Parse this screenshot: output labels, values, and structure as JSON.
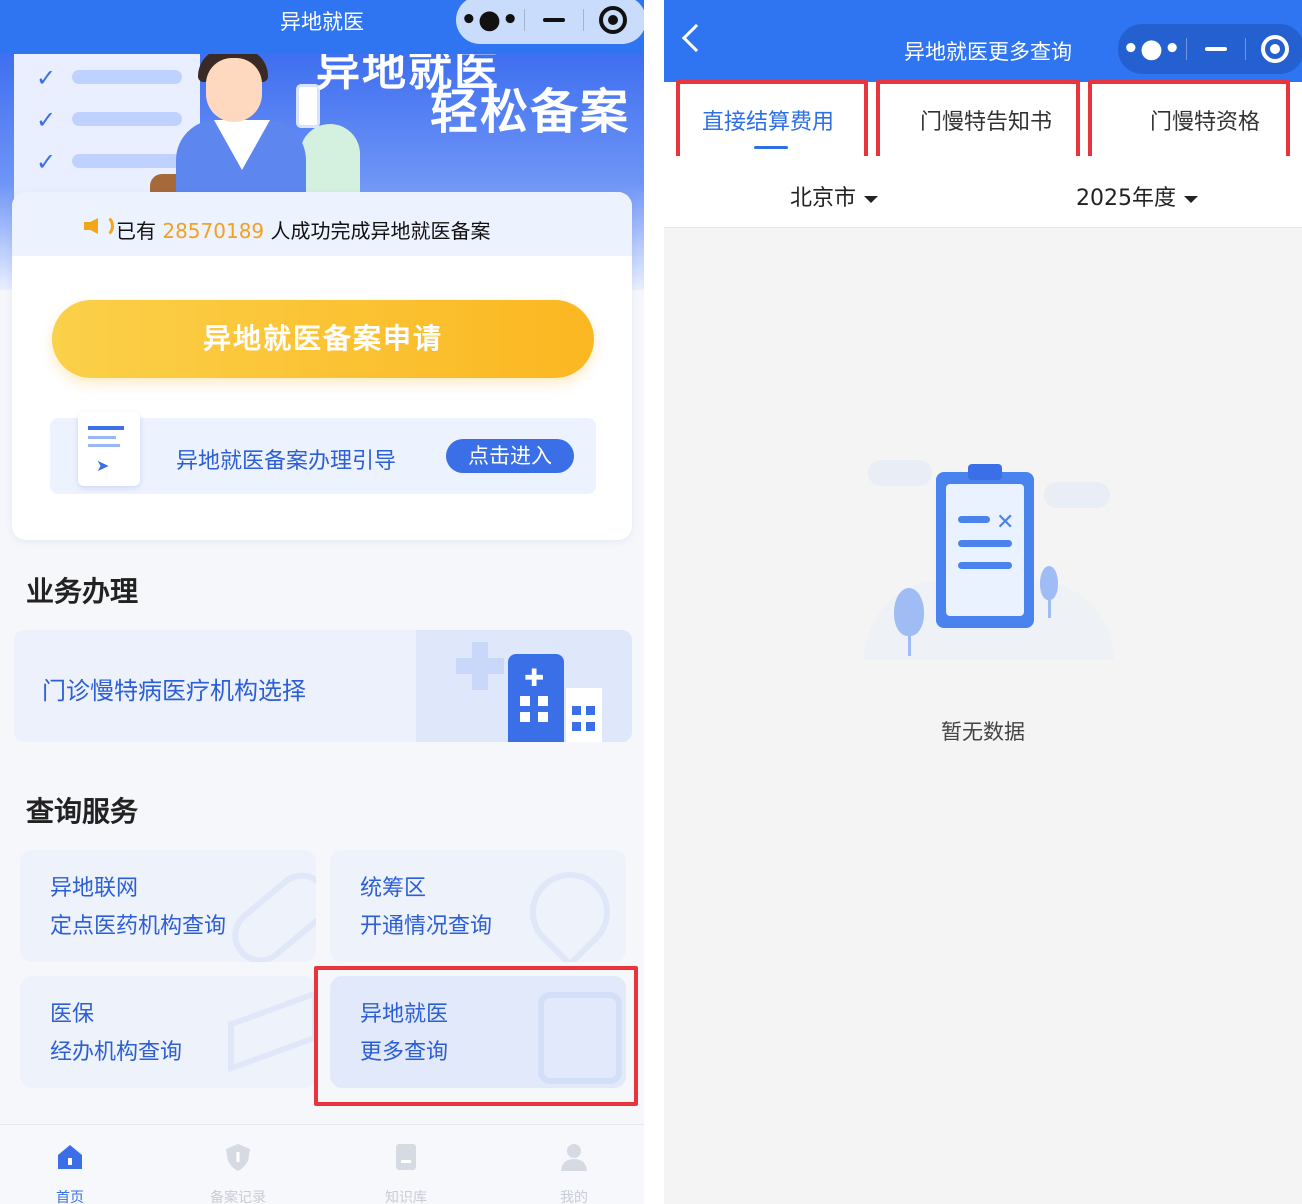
{
  "left": {
    "title": "异地就医",
    "banner": {
      "slogan_top": "异地就医",
      "slogan": "轻松备案"
    },
    "notice": {
      "prefix": "已有",
      "count": "28570189",
      "suffix": "人成功完成异地就医备案"
    },
    "apply_button": "异地就医备案申请",
    "guide": {
      "text": "异地就医备案办理引导",
      "button": "点击进入"
    },
    "business": {
      "title": "业务办理",
      "item": "门诊慢特病医疗机构选择"
    },
    "query": {
      "title": "查询服务",
      "cards": [
        {
          "line1": "异地联网",
          "line2": "定点医药机构查询"
        },
        {
          "line1": "统筹区",
          "line2": "开通情况查询"
        },
        {
          "line1": "医保",
          "line2": "经办机构查询"
        },
        {
          "line1": "异地就医",
          "line2": "更多查询"
        }
      ]
    },
    "tabbar": [
      {
        "label": "首页",
        "icon": "home-icon",
        "active": true
      },
      {
        "label": "备案记录",
        "icon": "shield-icon",
        "active": false
      },
      {
        "label": "知识库",
        "icon": "book-icon",
        "active": false
      },
      {
        "label": "我的",
        "icon": "user-icon",
        "active": false
      }
    ]
  },
  "right": {
    "title": "异地就医更多查询",
    "tabs": [
      {
        "label": "直接结算费用",
        "active": true
      },
      {
        "label": "门慢特告知书",
        "active": false
      },
      {
        "label": "门慢特资格",
        "active": false
      }
    ],
    "filters": {
      "city": "北京市",
      "year": "2025年度"
    },
    "empty_text": "暂无数据"
  },
  "colors": {
    "brand_blue": "#2f74f0",
    "accent_orange": "#f4a021",
    "highlight_red": "#e8343d"
  }
}
